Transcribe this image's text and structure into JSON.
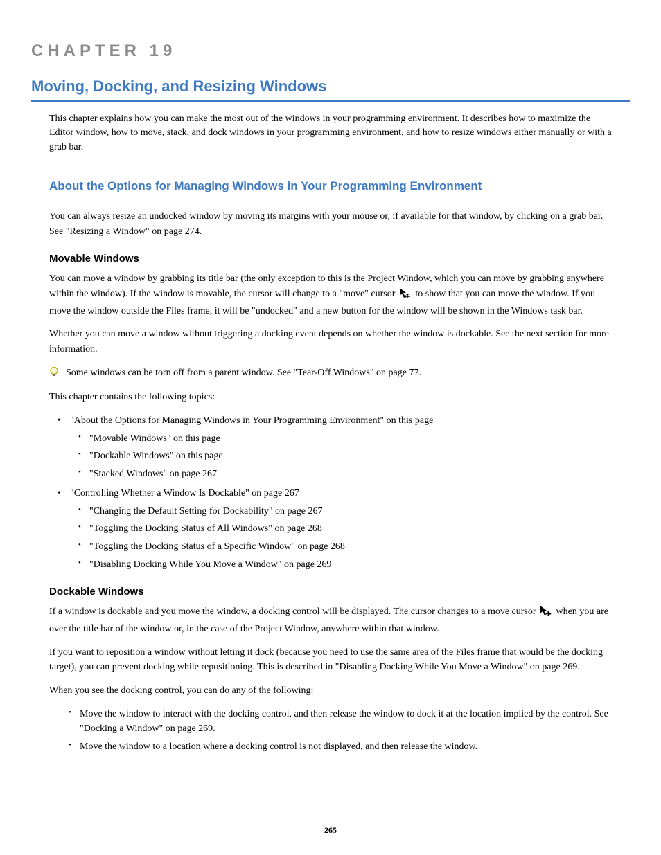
{
  "chapter_label": "CHAPTER 19",
  "chapter_title": "Moving, Docking, and Resizing Windows",
  "intro": "This chapter explains how you can make the most out of the windows in your programming environment. It describes how to maximize the Editor window, how to move, stack, and dock windows in your programming environment, and how to resize windows either manually or with a grab bar.",
  "section_title": "About the Options for Managing Windows in Your Programming Environment",
  "movable_heading": "Movable Windows",
  "dockable_heading": "Dockable Windows",
  "para_resize_1": "You can always resize an undocked window by moving its margins with your mouse or, if available for that window, by clicking on a grab bar. See ",
  "para_resize_2": "\"Resizing a Window\"",
  "para_resize_3": " on page 274.",
  "para_move_1_a": "You can move a window by grabbing its title bar (the only exception to this is the Project Window, which you can move by grabbing anywhere within the window). If the window is movable, the cursor will change to a \"move\" cursor ",
  "para_move_1_b": " to show that you can move the window. If you move the window outside the Files frame, it will be \"undocked\" and a new button for the window will be shown in the Windows task bar.",
  "para_move_2": "Whether you can move a window without triggering a docking event depends on whether the window is dockable. See the next section for more information.",
  "tip": "Some windows can be torn off from a parent window. See \"Tear-Off Windows\" on page 77.",
  "topics_intro": "This chapter contains the following topics:",
  "topics": [
    "\"About the Options for Managing Windows in Your Programming Environment\"",
    "this page"
  ],
  "sub_l2_a": [
    "\"Movable Windows\" on this page",
    "\"Dockable Windows\" on this page",
    "\"Stacked Windows\" on page 267"
  ],
  "topic_whether_text": "\"Controlling Whether a Window Is Dockable\" on page 267",
  "sub_l2_b": [
    "\"Changing the Default Setting for Dockability\" on page 267",
    "\"Toggling the Docking Status of All Windows\" on page 268",
    "\"Toggling the Docking Status of a Specific Window\" on page 268",
    "\"Disabling Docking While You Move a Window\" on page 269"
  ],
  "dock_p1_a": "If a window is dockable and you move the window, a docking control will be displayed. The cursor changes to a move cursor ",
  "dock_p1_b": " when you are over the title bar of the window or, in the case of the Project Window, anywhere within that window.",
  "dock_p2": "If you want to reposition a window without letting it dock (because you need to use the same area of the Files frame that would be the docking target), you can prevent docking while repositioning. This is described in \"Disabling Docking While You Move a Window\" on page 269.",
  "dock_p3": "When you see the docking control, you can do any of the following:",
  "dock_bullets": [
    "Move the window to interact with the docking control, and then release the window to dock it at the location implied by the control. See \"Docking a Window\" on page 269.",
    "Move the window to a location where a docking control is not displayed, and then release the window."
  ],
  "page_number": "265"
}
